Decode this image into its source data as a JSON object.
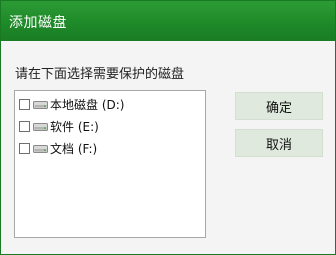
{
  "window": {
    "title": "添加磁盘"
  },
  "prompt": "请在下面选择需要保护的磁盘",
  "disks": [
    {
      "label": "本地磁盘 (D:)",
      "checked": false
    },
    {
      "label": "软件 (E:)",
      "checked": false
    },
    {
      "label": "文档 (F:)",
      "checked": false
    }
  ],
  "buttons": {
    "ok_label": "确定",
    "cancel_label": "取消"
  },
  "colors": {
    "titlebar": "#1e8a29",
    "button_bg": "#dfe9dd"
  }
}
